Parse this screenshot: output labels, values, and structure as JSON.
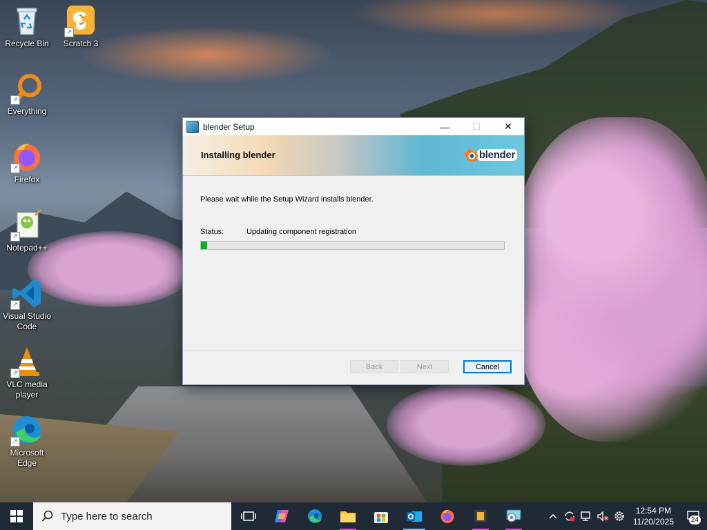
{
  "desktop": {
    "icons": [
      {
        "label": "Recycle Bin"
      },
      {
        "label": "Scratch 3"
      },
      {
        "label": "Everything"
      },
      {
        "label": "Firefox"
      },
      {
        "label": "Notepad++"
      },
      {
        "label": "Visual Studio Code"
      },
      {
        "label": "VLC media player"
      },
      {
        "label": "Microsoft Edge"
      }
    ]
  },
  "dialog": {
    "title": "blender Setup",
    "heading": "Installing blender",
    "logo_text": "blender",
    "wait_message": "Please wait while the Setup Wizard installs blender.",
    "status_label": "Status:",
    "status_text": "Updating component registration",
    "progress_percent": 2,
    "buttons": {
      "back": "Back",
      "next": "Next",
      "cancel": "Cancel"
    },
    "window_controls": {
      "minimize": "—",
      "maximize": "☐",
      "close": "✕"
    }
  },
  "taskbar": {
    "search_placeholder": "Type here to search",
    "apps": [
      "Task View",
      "Copilot",
      "Microsoft Edge",
      "File Explorer",
      "Microsoft Store",
      "Outlook",
      "Firefox",
      "Scratch 3",
      "blender Setup"
    ],
    "clock": {
      "time": "12:54 PM",
      "date": "11/20/2025"
    },
    "notification_count": "24",
    "tray_icons": [
      "chevron-up-icon",
      "sync-icon",
      "network-icon",
      "volume-muted-icon",
      "settings-icon"
    ]
  },
  "colors": {
    "progress_fill": "#06b025",
    "accent": "#0078d7",
    "taskbar_bg": "#1f2a36"
  }
}
